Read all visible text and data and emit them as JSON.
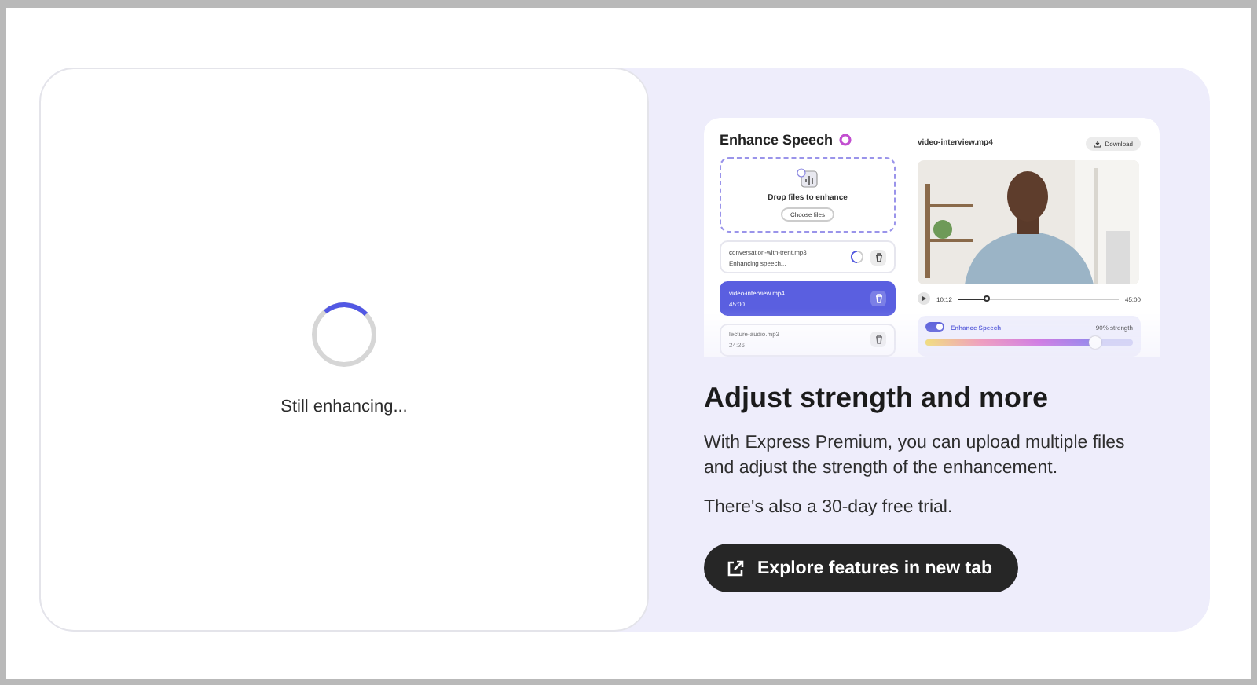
{
  "loading": {
    "text": "Still enhancing..."
  },
  "preview": {
    "title": "Enhance Speech",
    "dropzone": {
      "text": "Drop files to enhance",
      "button": "Choose files"
    },
    "files": [
      {
        "name": "conversation-with-trent.mp3",
        "detail": "Enhancing speech...",
        "kind": "processing",
        "selected": false
      },
      {
        "name": "video-interview.mp4",
        "detail": "45:00",
        "kind": "done",
        "selected": true
      },
      {
        "name": "lecture-audio.mp3",
        "detail": "24:26",
        "kind": "done",
        "selected": false
      }
    ],
    "player": {
      "filename": "video-interview.mp4",
      "download": "Download",
      "current_time": "10:12",
      "duration": "45:00",
      "level": 0.18
    },
    "enhance": {
      "label": "Enhance Speech",
      "on": true,
      "strength": "90% strength",
      "level": 0.82
    }
  },
  "promo": {
    "title": "Adjust strength and more",
    "paragraphs": [
      "With Express Premium, you can upload multiple files and adjust the strength of the enhancement.",
      "There's also a 30-day free trial."
    ],
    "button": "Explore features in new tab"
  }
}
